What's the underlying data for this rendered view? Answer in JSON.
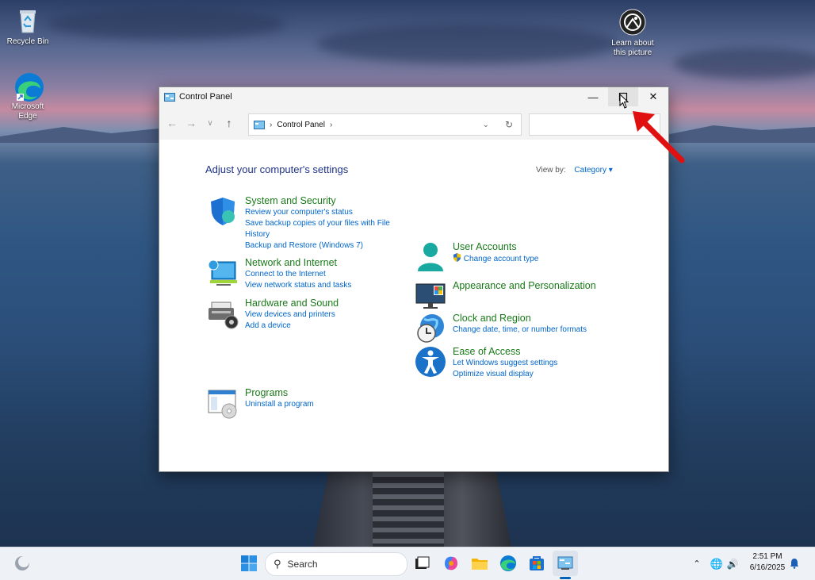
{
  "desktop": {
    "icons": [
      {
        "label": "Recycle Bin"
      },
      {
        "label": "Microsoft Edge"
      },
      {
        "label": "Learn about this picture"
      }
    ]
  },
  "window": {
    "title": "Control Panel",
    "buttons": {
      "minimize": "—",
      "maximize": "☐",
      "close": "✕"
    },
    "address": {
      "root": "Control Panel"
    },
    "search": {
      "value": ""
    },
    "heading": "Adjust your computer's settings",
    "view_by": {
      "label": "View by:",
      "value": "Category"
    },
    "left_categories": [
      {
        "title": "System and Security",
        "links": [
          "Review your computer's status",
          "Save backup copies of your files with File History",
          "Backup and Restore (Windows 7)"
        ]
      },
      {
        "title": "Network and Internet",
        "links": [
          "Connect to the Internet",
          "View network status and tasks"
        ]
      },
      {
        "title": "Hardware and Sound",
        "links": [
          "View devices and printers",
          "Add a device"
        ]
      },
      {
        "title": "Programs",
        "links": [
          "Uninstall a program"
        ]
      }
    ],
    "right_categories": [
      {
        "title": "User Accounts",
        "links": [
          "Change account type"
        ]
      },
      {
        "title": "Appearance and Personalization",
        "links": []
      },
      {
        "title": "Clock and Region",
        "links": [
          "Change date, time, or number formats"
        ]
      },
      {
        "title": "Ease of Access",
        "links": [
          "Let Windows suggest settings",
          "Optimize visual display"
        ]
      }
    ]
  },
  "taskbar": {
    "search_placeholder": "Search",
    "time": "2:51 PM",
    "date": "6/16/2025"
  },
  "colors": {
    "link": "#0066cc",
    "category_title": "#1a7a1a",
    "heading": "#1e3287",
    "arrow": "#e01010"
  }
}
